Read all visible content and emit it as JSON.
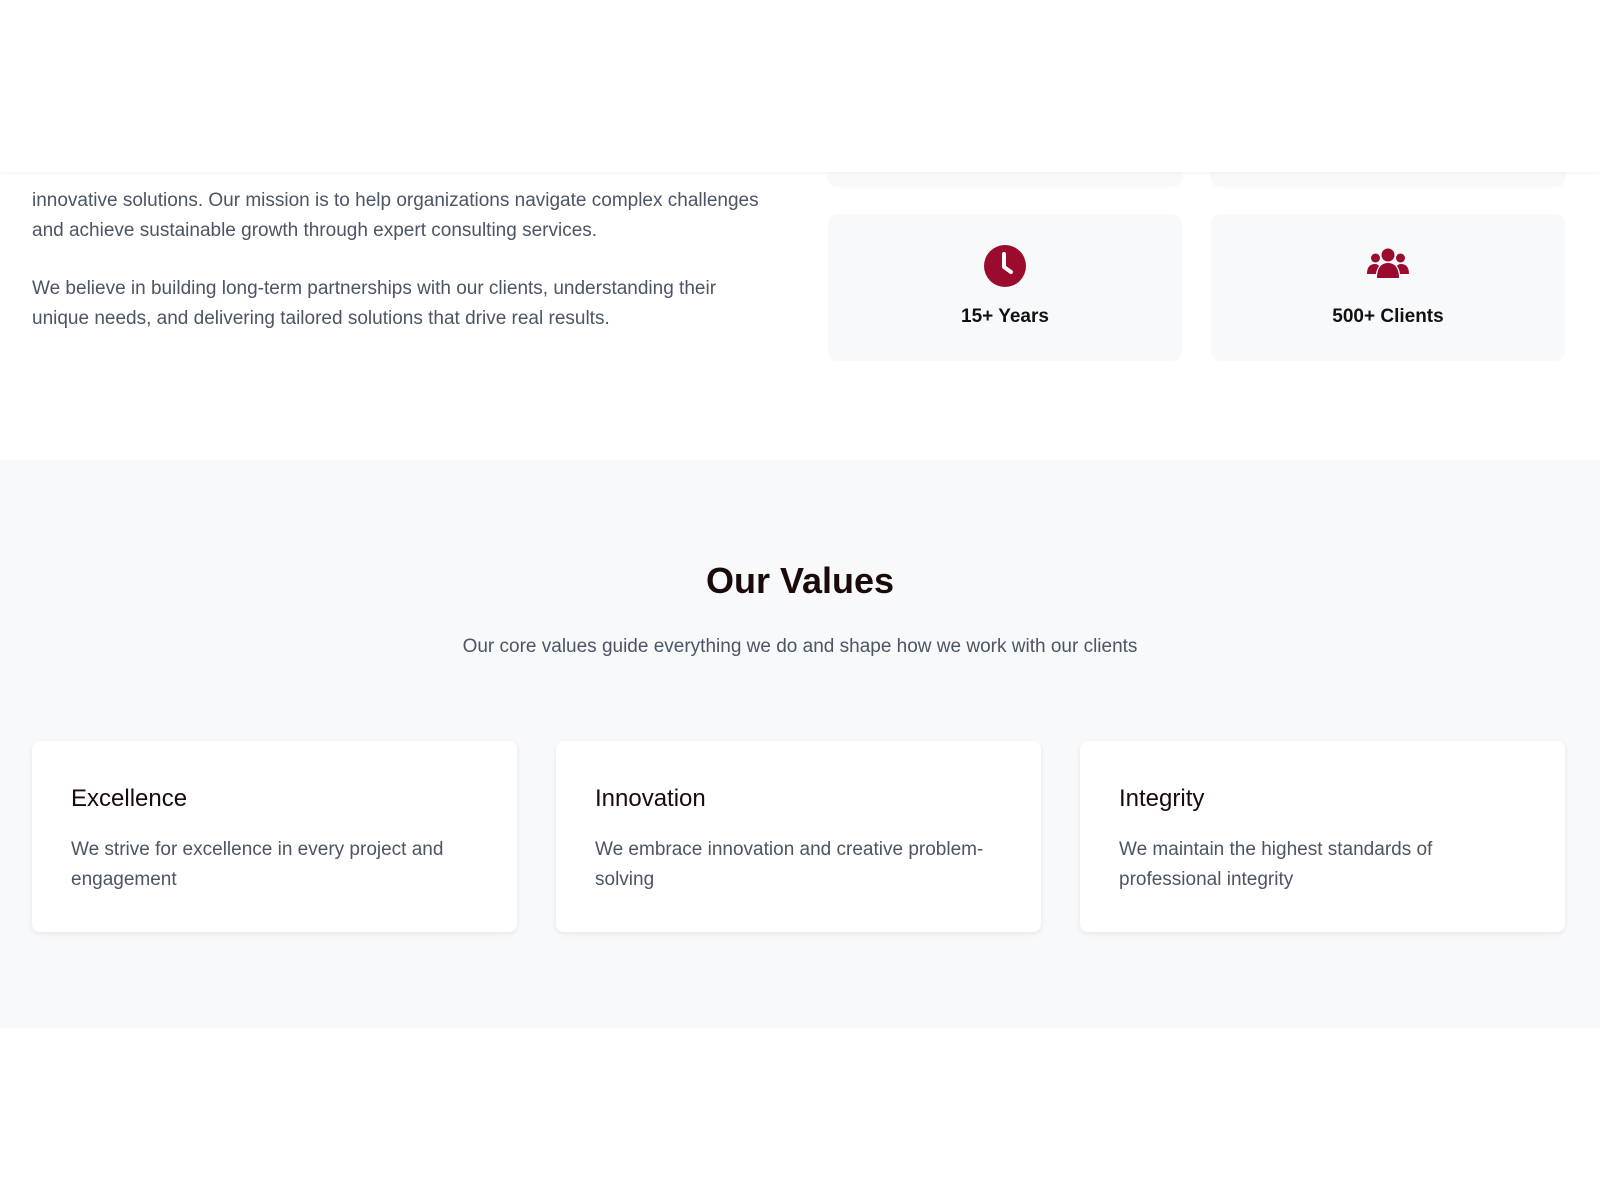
{
  "about": {
    "paragraph_1": "innovative solutions. Our mission is to help organizations navigate complex challenges and achieve sustainable growth through expert consulting services.",
    "paragraph_2": "We believe in building long-term partnerships with our clients, understanding their unique needs, and delivering tailored solutions that drive real results."
  },
  "stats": [
    {
      "icon": "clock-icon",
      "label": "15+ Years"
    },
    {
      "icon": "users-icon",
      "label": "500+ Clients"
    }
  ],
  "values": {
    "title": "Our Values",
    "subtitle": "Our core values guide everything we do and shape how we work with our clients",
    "cards": [
      {
        "title": "Excellence",
        "description": "We strive for excellence in every project and engagement"
      },
      {
        "title": "Innovation",
        "description": "We embrace innovation and creative problem-solving"
      },
      {
        "title": "Integrity",
        "description": "We maintain the highest standards of professional integrity"
      }
    ]
  },
  "colors": {
    "accent": "#9b0b2e",
    "heading": "#1a0a0a",
    "body_text": "#4b5563",
    "section_bg": "#f8f9fb"
  }
}
